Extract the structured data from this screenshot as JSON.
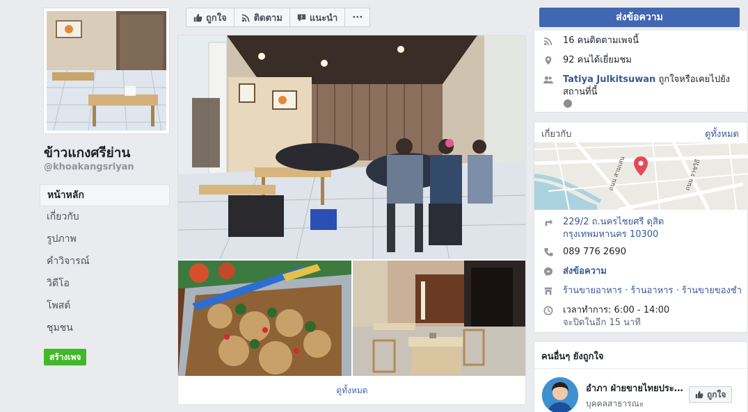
{
  "page": {
    "name": "ข้าวแกงศรีย่าน",
    "handle": "@khoakangsriyan"
  },
  "nav": {
    "items": [
      {
        "label": "หน้าหลัก"
      },
      {
        "label": "เกี่ยวกับ"
      },
      {
        "label": "รูปภาพ"
      },
      {
        "label": "คำวิจารณ์"
      },
      {
        "label": "วิดีโอ"
      },
      {
        "label": "โพสต์"
      },
      {
        "label": "ชุมชน"
      }
    ],
    "create_page_label": "สร้างเพจ"
  },
  "action_bar": {
    "like_label": "ถูกใจ",
    "follow_label": "ติดตาม",
    "recommend_label": "แนะนำ",
    "more_label": "···"
  },
  "send_message_label": "ส่งข้อความ",
  "photos": {
    "see_all_label": "ดูทั้งหมด"
  },
  "stats": {
    "followers": "16 คนติดตามเพจนี้",
    "visited": "92 คนได้เยี่ยมชม",
    "friend_name": "Tatiya Julkitsuwan",
    "friend_text": "ถูกใจหรือเคยไปยังสถานที่นี้"
  },
  "about": {
    "title": "เกี่ยวกับ",
    "see_all_label": "ดูทั้งหมด",
    "address_line1": "229/2 ถ.นครไชยศรี ดุสิต",
    "address_line2": "กรุงเทพมหานคร 10300",
    "phone": "089 776 2690",
    "message_label": "ส่งข้อความ",
    "categories": "ร้านขายอาหาร · ร้านอาหาร · ร้านขายของชำ",
    "hours": "เวลาทำการ: 6:00 - 14:00",
    "closing_note": "จะปิดในอีก 15 นาที",
    "map_labels": {
      "street_a": "ถนน สามเสน",
      "street_b": "ถนน ราชวิถี"
    }
  },
  "people_also_like": {
    "title": "คนอื่นๆ ยังถูกใจ",
    "name": "อำภา ฝ่ายขายไทยประกันชีวิต",
    "subtitle": "บุคคลสาธารณะ",
    "like_label": "ถูกใจ"
  },
  "colors": {
    "brand_blue": "#4267b2",
    "link_blue": "#385898",
    "create_green": "#42b72a",
    "map_pin": "#e4495a",
    "background": "#e9ebee"
  }
}
